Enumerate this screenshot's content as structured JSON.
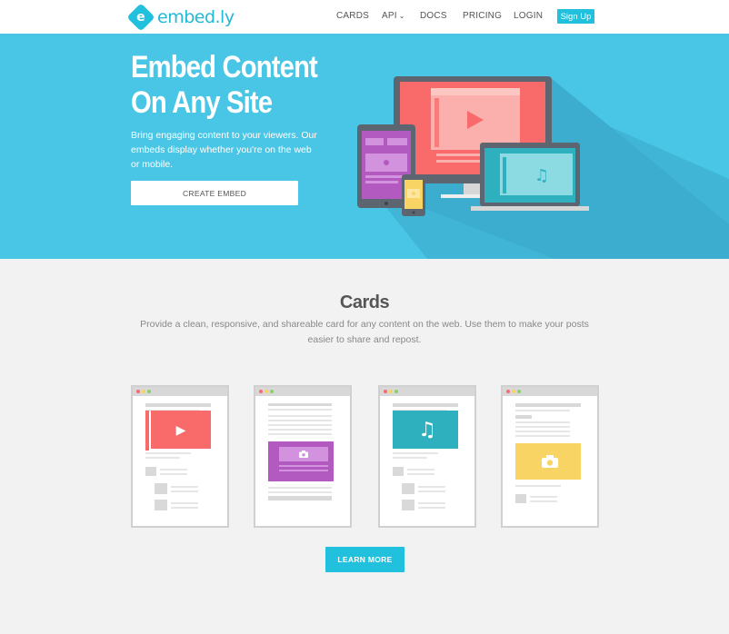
{
  "header": {
    "logo_mark": "e",
    "logo_text": "embed.ly",
    "nav": {
      "cards": "CARDS",
      "api": "API",
      "docs": "DOCS",
      "pricing": "PRICING",
      "login": "LOGIN",
      "signup": "Sign Up"
    }
  },
  "hero": {
    "title": "Embed Content On Any Site",
    "subtitle": "Bring engaging content to your viewers. Our embeds display whether you're on the web or mobile.",
    "cta": "CREATE EMBED"
  },
  "cards_section": {
    "title": "Cards",
    "description": "Provide a clean, responsive, and shareable card for any content on the web. Use them to make your posts easier to share and repost.",
    "cta": "LEARN MORE"
  },
  "colors": {
    "brand": "#21c0dc",
    "hero_bg": "#49c6e5",
    "video": "#f96a6a",
    "photo": "#b25ac0",
    "audio": "#2fb0bf",
    "image": "#f8d465"
  },
  "icons": {
    "play": "▶",
    "music": "♫",
    "camera": "camera-icon",
    "chevron": "⌄"
  }
}
